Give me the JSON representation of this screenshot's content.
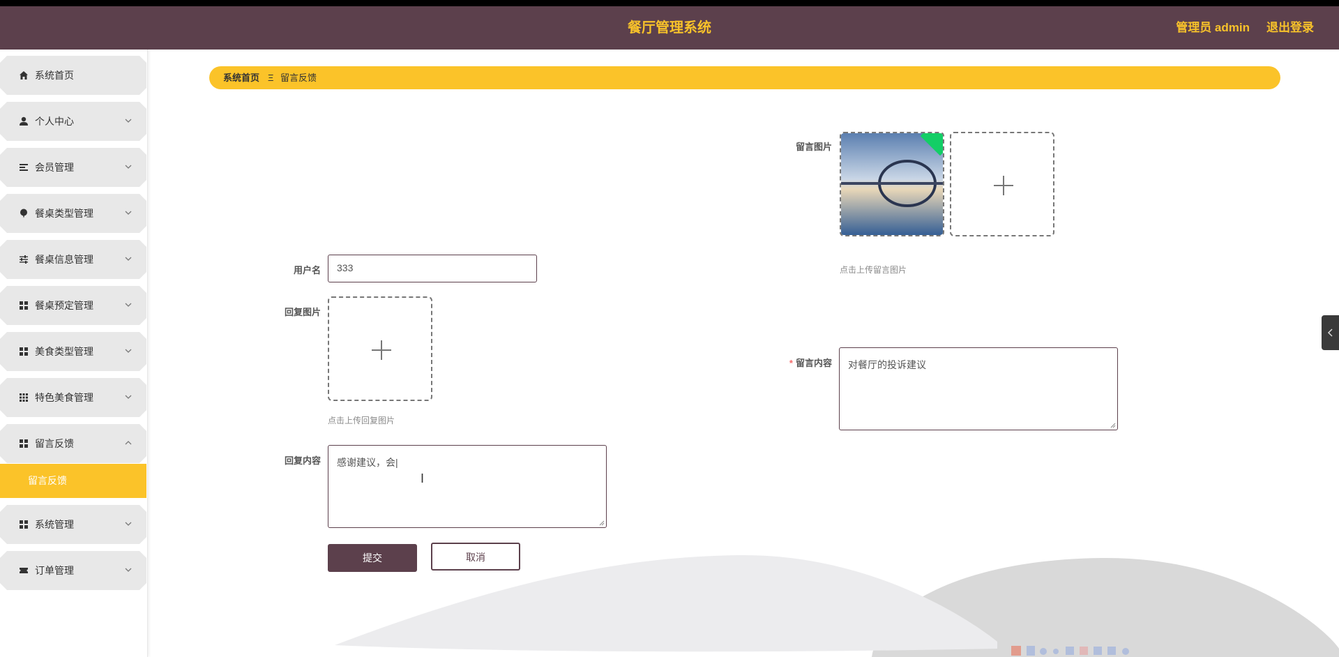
{
  "header": {
    "title": "餐厅管理系统",
    "admin_label": "管理员 admin",
    "logout_label": "退出登录"
  },
  "sidebar": {
    "items": [
      {
        "label": "系统首页",
        "icon": "home-icon"
      },
      {
        "label": "个人中心",
        "icon": "user-icon"
      },
      {
        "label": "会员管理",
        "icon": "list-icon"
      },
      {
        "label": "餐桌类型管理",
        "icon": "balloon-icon"
      },
      {
        "label": "餐桌信息管理",
        "icon": "sliders-icon"
      },
      {
        "label": "餐桌预定管理",
        "icon": "grid-icon"
      },
      {
        "label": "美食类型管理",
        "icon": "grid-icon"
      },
      {
        "label": "特色美食管理",
        "icon": "grid9-icon"
      },
      {
        "label": "留言反馈",
        "icon": "grid-icon"
      },
      {
        "label": "系统管理",
        "icon": "grid-icon"
      },
      {
        "label": "订单管理",
        "icon": "ticket-icon"
      }
    ],
    "active_sub": "留言反馈"
  },
  "breadcrumb": {
    "home": "系统首页",
    "separator": "Ξ",
    "current": "留言反馈"
  },
  "form": {
    "message_image_label": "留言图片",
    "message_image_hint": "点击上传留言图片",
    "username_label": "用户名",
    "username_value": "333",
    "reply_image_label": "回复图片",
    "reply_image_hint": "点击上传回复图片",
    "message_content_label": "留言内容",
    "message_content_value": "对餐厅的投诉建议",
    "reply_content_label": "回复内容",
    "reply_content_value": "感谢建议，会|",
    "submit_label": "提交",
    "cancel_label": "取消"
  },
  "colors": {
    "header_bg": "#5c404c",
    "accent": "#fbc329",
    "title_text": "#f8c22a",
    "success_badge": "#13ce66"
  }
}
